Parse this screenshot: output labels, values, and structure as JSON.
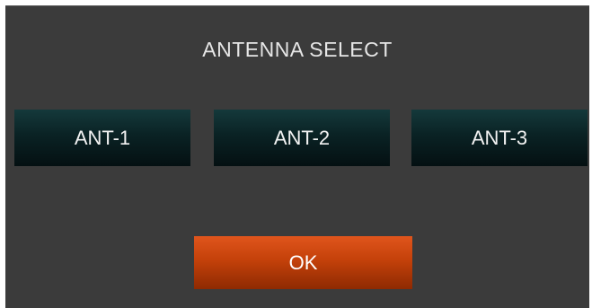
{
  "dialog": {
    "title": "ANTENNA SELECT",
    "antenna_buttons": [
      {
        "label": "ANT-1"
      },
      {
        "label": "ANT-2"
      },
      {
        "label": "ANT-3"
      }
    ],
    "ok_label": "OK"
  },
  "colors": {
    "panel_background": "#3b3b3b",
    "antenna_button": "#0a2224",
    "ok_button": "#c4410a",
    "text": "#f2f2f2"
  }
}
